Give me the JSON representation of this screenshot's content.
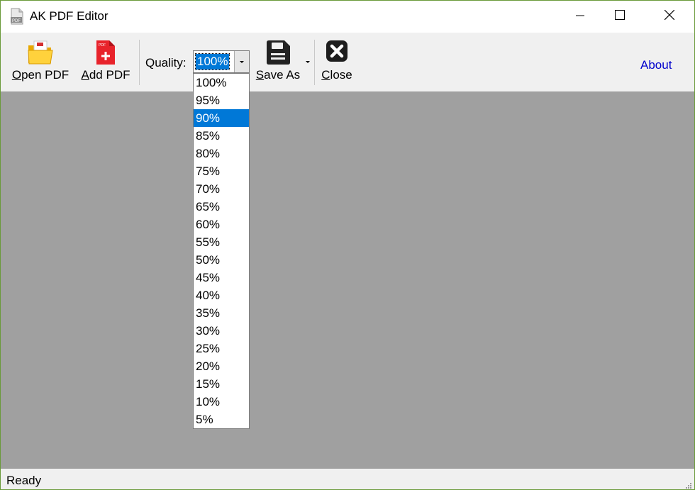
{
  "window": {
    "title": "AK PDF Editor"
  },
  "icons": {
    "app": "pdf-file-icon",
    "minimize": "minimize-icon",
    "maximize": "maximize-icon",
    "close": "close-icon",
    "open_pdf": "folder-pdf-icon",
    "add_pdf": "add-pdf-icon",
    "save_as": "floppy-disk-icon",
    "close_doc": "close-x-icon"
  },
  "toolbar": {
    "open_pdf_mnemonic": "O",
    "open_pdf_rest": "pen PDF",
    "add_pdf_mnemonic": "A",
    "add_pdf_rest": "dd PDF",
    "quality_label": "Quality:",
    "quality_value": "100%",
    "save_as_mnemonic": "S",
    "save_as_rest": "ave As",
    "close_mnemonic": "C",
    "close_rest": "lose",
    "about": "About"
  },
  "quality_dropdown": {
    "options": [
      "100%",
      "95%",
      "90%",
      "85%",
      "80%",
      "75%",
      "70%",
      "65%",
      "60%",
      "55%",
      "50%",
      "45%",
      "40%",
      "35%",
      "30%",
      "25%",
      "20%",
      "15%",
      "10%",
      "5%"
    ],
    "highlighted": "90%"
  },
  "status": {
    "text": "Ready"
  },
  "colors": {
    "accent": "#0078d7",
    "workspace": "#a0a0a0",
    "link": "#0000cc"
  }
}
